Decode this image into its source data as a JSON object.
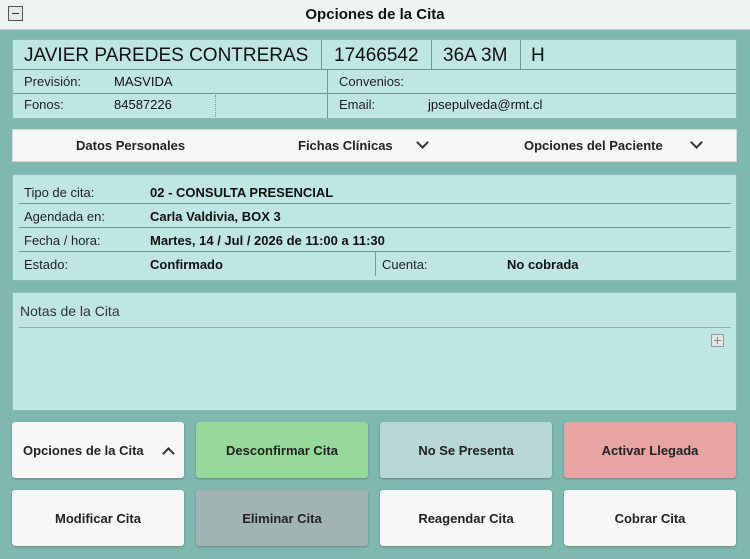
{
  "window": {
    "title": "Opciones de la Cita"
  },
  "patient": {
    "name": "JAVIER PAREDES CONTRERAS",
    "id": "17466542",
    "age": "36A 3M",
    "sex": "H",
    "prevision_label": "Previsión:",
    "prevision_value": "MASVIDA",
    "convenios_label": "Convenios:",
    "convenios_value": "",
    "fonos_label": "Fonos:",
    "fonos_value": "84587226",
    "email_label": "Email:",
    "email_value": "jpsepulveda@rmt.cl"
  },
  "nav": {
    "datos_personales": "Datos Personales",
    "fichas_clinicas": "Fichas Clínicas",
    "opciones_paciente": "Opciones del Paciente"
  },
  "appointment": {
    "tipo_label": "Tipo de cita:",
    "tipo_value": "02 - CONSULTA PRESENCIAL",
    "agendada_label": "Agendada en:",
    "agendada_value": "Carla Valdivia, BOX 3",
    "fecha_label": "Fecha / hora:",
    "fecha_value": "Martes, 14 / Jul / 2026 de 11:00 a 11:30",
    "estado_label": "Estado:",
    "estado_value": "Confirmado",
    "cuenta_label": "Cuenta:",
    "cuenta_value": "No cobrada"
  },
  "notes": {
    "title": "Notas de la Cita"
  },
  "buttons": {
    "opciones_cita": "Opciones de la Cita",
    "desconfirmar": "Desconfirmar Cita",
    "no_presenta": "No Se Presenta",
    "activar_llegada": "Activar Llegada",
    "modificar": "Modificar Cita",
    "eliminar": "Eliminar Cita",
    "reagendar": "Reagendar Cita",
    "cobrar": "Cobrar Cita"
  },
  "colors": {
    "panel": "#c0e6e3",
    "desconfirmar": "#97d89b",
    "no_presenta": "#b9d8d5",
    "activar_llegada": "#e8a3a3",
    "eliminar": "#a1b4b2",
    "white_button": "#f7f7f7"
  }
}
